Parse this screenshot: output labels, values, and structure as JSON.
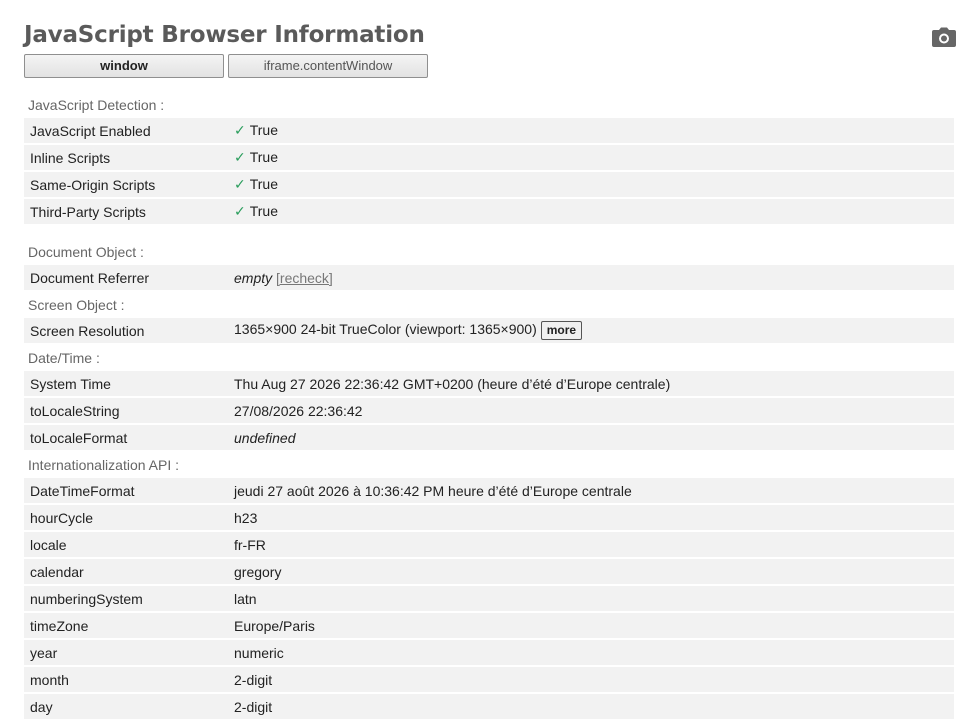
{
  "title": "JavaScript Browser Information",
  "tabs": [
    "window",
    "iframe.contentWindow"
  ],
  "sections": {
    "js": {
      "label": "JavaScript Detection :",
      "rows": [
        {
          "key": "JavaScript Enabled",
          "value": "True"
        },
        {
          "key": "Inline Scripts",
          "value": "True"
        },
        {
          "key": "Same-Origin Scripts",
          "value": "True"
        },
        {
          "key": "Third-Party Scripts",
          "value": "True"
        }
      ],
      "check_glyph": "✓"
    },
    "document": {
      "label": "Document Object :",
      "referrer_key": "Document Referrer",
      "referrer_value": "empty",
      "recheck_label": "[recheck]"
    },
    "screen": {
      "label": "Screen Object :",
      "key": "Screen Resolution",
      "value": "1365×900 24-bit TrueColor (viewport: 1365×900)",
      "more_label": "more"
    },
    "datetime": {
      "label": "Date/Time :",
      "rows": [
        {
          "key": "System Time",
          "value": "Thu Aug 27 2026 22:36:42 GMT+0200 (heure d’été d’Europe centrale)"
        },
        {
          "key": "toLocaleString",
          "value": "27/08/2026 22:36:42"
        }
      ],
      "format_key": "toLocaleFormat",
      "format_value": "undefined"
    },
    "intl": {
      "label": "Internationalization API :",
      "rows": [
        {
          "key": "DateTimeFormat",
          "value": "jeudi 27 août 2026 à 10:36:42 PM heure d’été d’Europe centrale"
        },
        {
          "key": "hourCycle",
          "value": "h23"
        },
        {
          "key": "locale",
          "value": "fr-FR"
        },
        {
          "key": "calendar",
          "value": "gregory"
        },
        {
          "key": "numberingSystem",
          "value": "latn"
        },
        {
          "key": "timeZone",
          "value": "Europe/Paris"
        },
        {
          "key": "year",
          "value": "numeric"
        },
        {
          "key": "month",
          "value": "2-digit"
        },
        {
          "key": "day",
          "value": "2-digit"
        }
      ]
    }
  },
  "colors": {
    "check": "#2a9d5c",
    "row_bg": "#f2f2f2",
    "title": "#5a5a5a"
  }
}
